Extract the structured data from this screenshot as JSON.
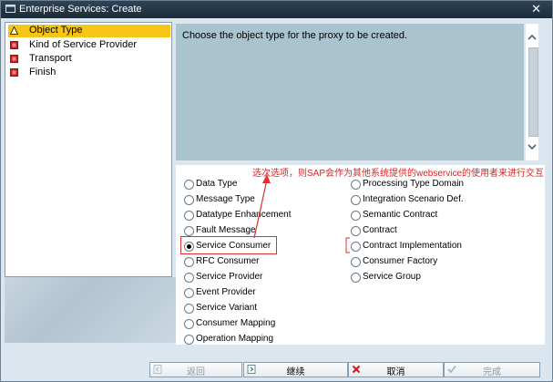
{
  "window": {
    "title": "Enterprise Services: Create",
    "close_glyph": "✕"
  },
  "steps": [
    {
      "label": "Object Type",
      "icon": "warning-triangle-icon",
      "active": true
    },
    {
      "label": "Kind of Service Provider",
      "icon": "red-flag-icon",
      "active": false
    },
    {
      "label": "Transport",
      "icon": "red-flag-icon",
      "active": false
    },
    {
      "label": "Finish",
      "icon": "red-flag-icon",
      "active": false
    }
  ],
  "description": {
    "text": "Choose the object type for the proxy to be created."
  },
  "options_left": [
    {
      "label": "Data Type",
      "selected": false
    },
    {
      "label": "Message Type",
      "selected": false
    },
    {
      "label": "Datatype Enhancement",
      "selected": false
    },
    {
      "label": "Fault Message",
      "selected": false
    },
    {
      "label": "Service Consumer",
      "selected": true
    },
    {
      "label": "RFC Consumer",
      "selected": false
    },
    {
      "label": "Service Provider",
      "selected": false
    },
    {
      "label": "Event Provider",
      "selected": false
    },
    {
      "label": "Service Variant",
      "selected": false
    },
    {
      "label": "Consumer Mapping",
      "selected": false
    },
    {
      "label": "Operation Mapping",
      "selected": false
    }
  ],
  "options_right": [
    {
      "label": "Processing Type Domain",
      "selected": false
    },
    {
      "label": "Integration Scenario Def.",
      "selected": false
    },
    {
      "label": "Semantic Contract",
      "selected": false
    },
    {
      "label": "Contract",
      "selected": false
    },
    {
      "label": "Contract Implementation",
      "selected": false
    },
    {
      "label": "Consumer Factory",
      "selected": false
    },
    {
      "label": "Service Group",
      "selected": false
    }
  ],
  "annotation": {
    "text": "选次选项，则SAP会作为其他系统提供的webservice的使用者来进行交互",
    "color": "#e02020"
  },
  "footer": {
    "back_label": "返回",
    "continue_label": "继续",
    "cancel_label": "取消",
    "finish_label": "完成"
  },
  "colors": {
    "active_step": "#f5c518",
    "description_bg": "#a9c3cf",
    "titlebar": "#22313f"
  }
}
